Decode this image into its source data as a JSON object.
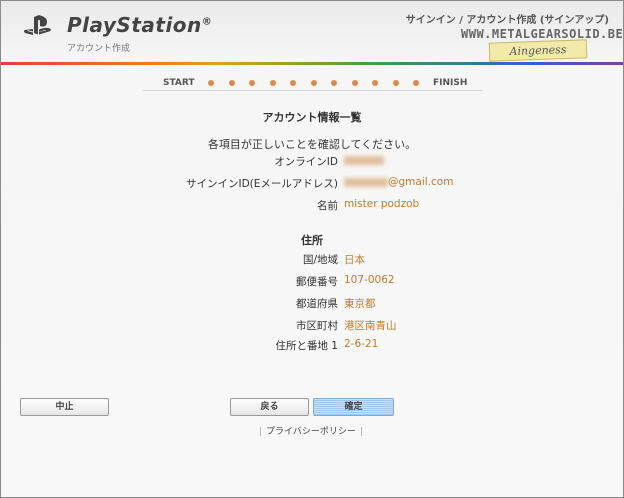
{
  "header": {
    "brand": "PlayStation",
    "brand_mark": "®",
    "subtitle": "アカウント作成",
    "page_label": "サインイン / アカウント作成 (サインアップ)",
    "watermark": "WWW.METALGEARSOLID.BE",
    "watermark_tag": "Aingeness"
  },
  "progress": {
    "start": "START",
    "finish": "FINISH",
    "steps": 11,
    "dot_color": "#e08a4a"
  },
  "main": {
    "title": "アカウント情報一覧",
    "confirm_message": "各項目が正しいことを確認してください。",
    "account_fields": [
      {
        "label": "オンラインID",
        "value": ""
      },
      {
        "label": "サインインID(Eメールアドレス)",
        "value": "@gmail.com"
      },
      {
        "label": "名前",
        "value": "mister podzob"
      }
    ],
    "address_heading": "住所",
    "address_fields": [
      {
        "label": "国/地域",
        "value": "日本"
      },
      {
        "label": "郵便番号",
        "value": "107-0062"
      },
      {
        "label": "都道府県",
        "value": "東京都"
      },
      {
        "label": "市区町村",
        "value": "港区南青山"
      },
      {
        "label": "住所と番地 1",
        "value": "2-6-21"
      }
    ]
  },
  "buttons": {
    "cancel": "中止",
    "back": "戻る",
    "confirm": "確定"
  },
  "footer": {
    "privacy": "プライバシーポリシー"
  },
  "colors": {
    "value_text": "#c07a2a",
    "confirm_button": "#9fc6ee"
  }
}
